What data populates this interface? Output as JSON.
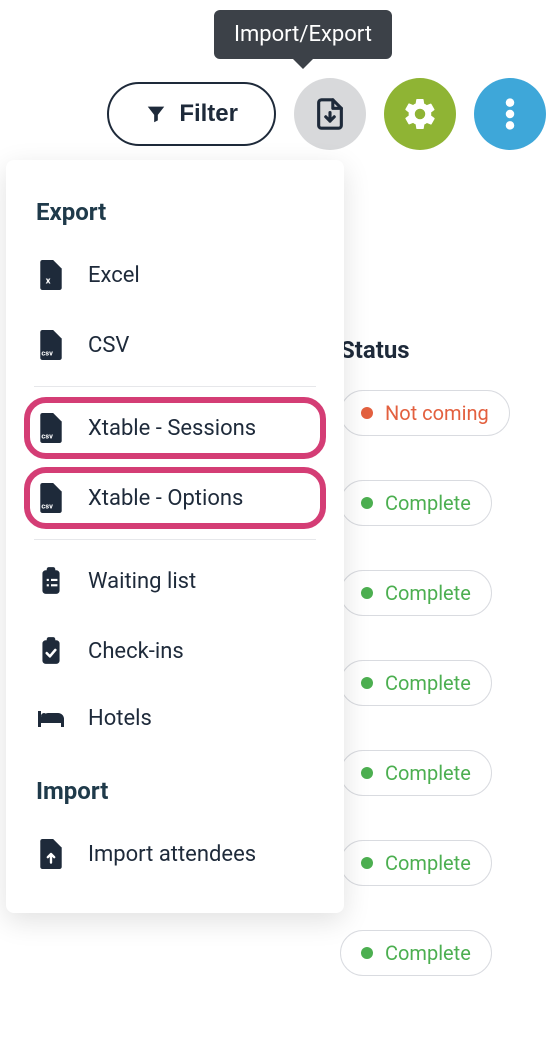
{
  "tooltip": {
    "label": "Import/Export"
  },
  "toolbar": {
    "filter_label": "Filter"
  },
  "dropdown": {
    "export_title": "Export",
    "import_title": "Import",
    "items": {
      "excel": "Excel",
      "csv": "CSV",
      "xtable_sessions": "Xtable - Sessions",
      "xtable_options": "Xtable - Options",
      "waiting_list": "Waiting list",
      "check_ins": "Check-ins",
      "hotels": "Hotels",
      "import_attendees": "Import attendees"
    }
  },
  "status": {
    "header": "Status",
    "badges": [
      {
        "label": "Not coming",
        "color": "red"
      },
      {
        "label": "Complete",
        "color": "green"
      },
      {
        "label": "Complete",
        "color": "green"
      },
      {
        "label": "Complete",
        "color": "green"
      },
      {
        "label": "Complete",
        "color": "green"
      },
      {
        "label": "Complete",
        "color": "green"
      },
      {
        "label": "Complete",
        "color": "green"
      }
    ]
  }
}
